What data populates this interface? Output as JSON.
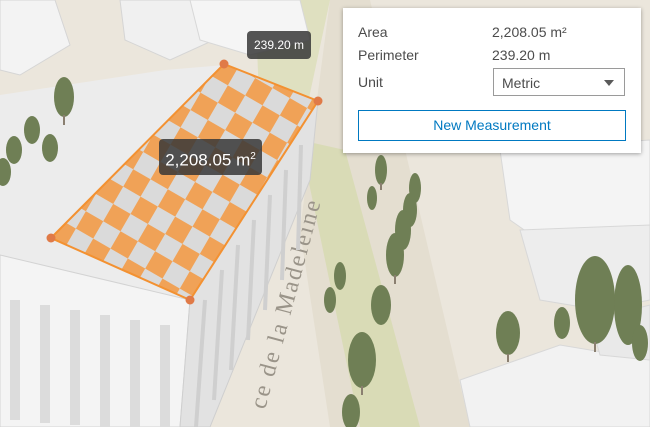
{
  "measurement_panel": {
    "area_label": "Area",
    "area_value": "2,208.05 m²",
    "perimeter_label": "Perimeter",
    "perimeter_value": "239.20 m",
    "unit_label": "Unit",
    "unit_selected": "Metric",
    "new_measurement_label": "New Measurement"
  },
  "map_labels": {
    "perimeter_tag": "239.20 m",
    "area_tag_value": "2,208.05 m",
    "area_tag_exponent": "2",
    "street_name": "ce de la Madeleine"
  },
  "colors": {
    "measure_fill": "#f09c4a",
    "measure_outline": "#f39131",
    "vertex": "#e07a47",
    "button_blue": "#0079c1",
    "tree": "#6f7f55"
  }
}
